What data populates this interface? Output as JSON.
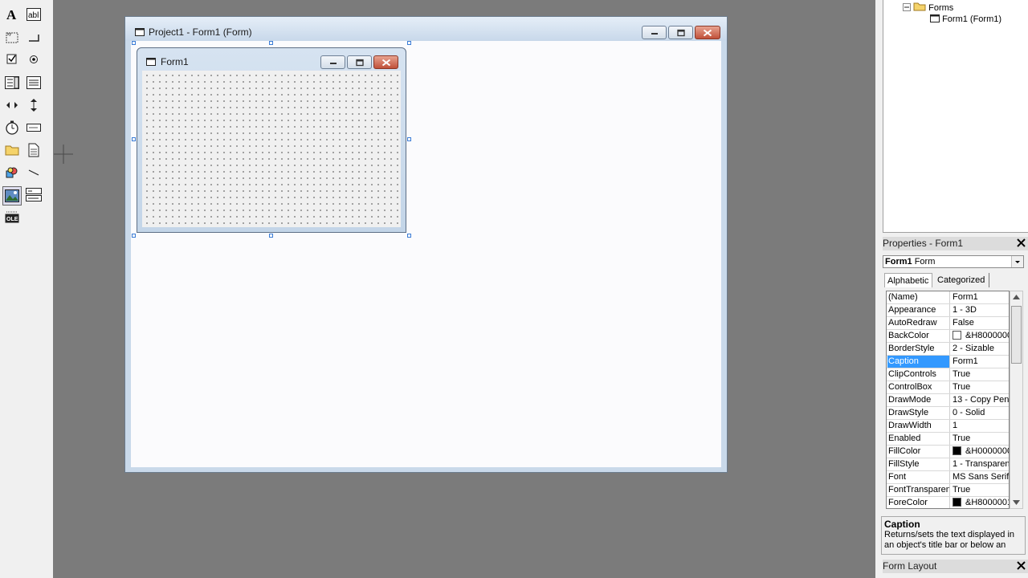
{
  "toolbox": {
    "tools": [
      {
        "name": "pointer-icon"
      },
      {
        "name": "label-icon"
      },
      {
        "name": "textbox-icon",
        "text": "abl"
      },
      {
        "name": "frame-icon"
      },
      {
        "name": "commandbutton-icon"
      },
      {
        "name": "checkbox-icon"
      },
      {
        "name": "optionbutton-icon"
      },
      {
        "name": "combobox-icon"
      },
      {
        "name": "listbox-icon"
      },
      {
        "name": "hscrollbar-icon"
      },
      {
        "name": "vscrollbar-icon"
      },
      {
        "name": "timer-icon"
      },
      {
        "name": "drivelistbox-icon"
      },
      {
        "name": "dirlistbox-icon"
      },
      {
        "name": "filelistbox-icon"
      },
      {
        "name": "shape-icon"
      },
      {
        "name": "line-icon"
      },
      {
        "name": "image-icon"
      },
      {
        "name": "data-icon"
      },
      {
        "name": "ole-icon",
        "text": "OLE"
      }
    ]
  },
  "designer": {
    "title": "Project1 - Form1 (Form)"
  },
  "form1": {
    "title": "Form1"
  },
  "project_tree": {
    "folder_label": "Forms",
    "item_label": "Form1 (Form1)"
  },
  "properties": {
    "panel_title": "Properties - Form1",
    "object_name": "Form1",
    "object_type": "Form",
    "tabs": [
      "Alphabetic",
      "Categorized"
    ],
    "rows": [
      {
        "name": "(Name)",
        "value": "Form1"
      },
      {
        "name": "Appearance",
        "value": "1 - 3D"
      },
      {
        "name": "AutoRedraw",
        "value": "False"
      },
      {
        "name": "BackColor",
        "value": "&H8000000",
        "swatch": "#ffffff"
      },
      {
        "name": "BorderStyle",
        "value": "2 - Sizable"
      },
      {
        "name": "Caption",
        "value": "Form1",
        "selected": true
      },
      {
        "name": "ClipControls",
        "value": "True"
      },
      {
        "name": "ControlBox",
        "value": "True"
      },
      {
        "name": "DrawMode",
        "value": "13 - Copy Pen"
      },
      {
        "name": "DrawStyle",
        "value": "0 - Solid"
      },
      {
        "name": "DrawWidth",
        "value": "1"
      },
      {
        "name": "Enabled",
        "value": "True"
      },
      {
        "name": "FillColor",
        "value": "&H0000000",
        "swatch": "#000000"
      },
      {
        "name": "FillStyle",
        "value": "1 - Transparen"
      },
      {
        "name": "Font",
        "value": "MS Sans Serif"
      },
      {
        "name": "FontTransparen",
        "value": "True"
      },
      {
        "name": "ForeColor",
        "value": "&H8000001",
        "swatch": "#000000"
      }
    ],
    "description_title": "Caption",
    "description_text": "Returns/sets the text displayed in an object's title bar or below an"
  },
  "form_layout": {
    "panel_title": "Form Layout"
  },
  "colors": {
    "workspace": "#7b7b7b",
    "selection": "#3399ff",
    "close_button": "#c0513a"
  }
}
